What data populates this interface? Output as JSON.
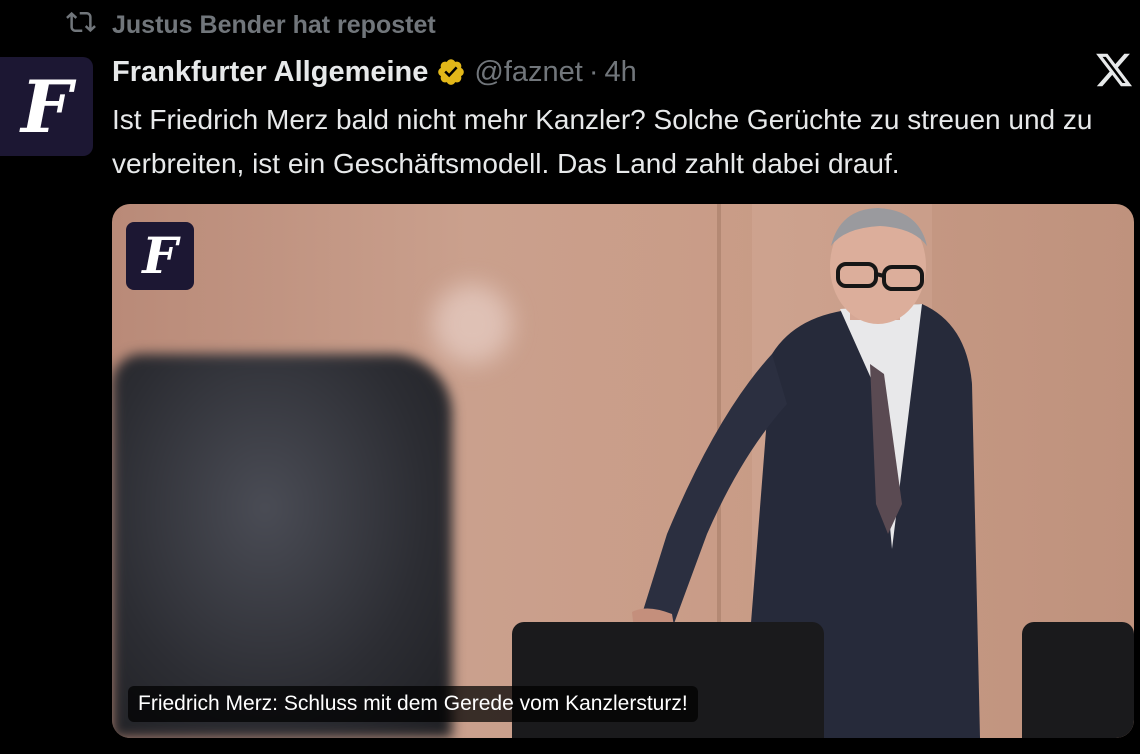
{
  "repost": {
    "icon": "repost-icon",
    "text": "Justus Bender hat repostet"
  },
  "avatar": {
    "icon": "faz-logo-icon",
    "glyph": "F"
  },
  "author": {
    "display_name": "Frankfurter Allgemeine",
    "verified_icon": "verified-badge-icon",
    "handle": "@faznet",
    "separator": "·",
    "time": "4h"
  },
  "x_logo": "x-logo-icon",
  "tweet": {
    "text": "Ist Friedrich Merz bald nicht mehr Kanzler? Solche Gerüchte zu streuen und zu verbreiten, ist ein Geschäftsmodell. Das Land zahlt dabei drauf."
  },
  "media": {
    "logo_glyph": "F",
    "caption": "Friedrich Merz: Schluss mit dem Gerede vom Kanzlersturz!"
  },
  "colors": {
    "background": "#000000",
    "text": "#e7e9ea",
    "muted": "#71767b",
    "verified": "#e2b719",
    "faz_brand": "#1c1733"
  }
}
